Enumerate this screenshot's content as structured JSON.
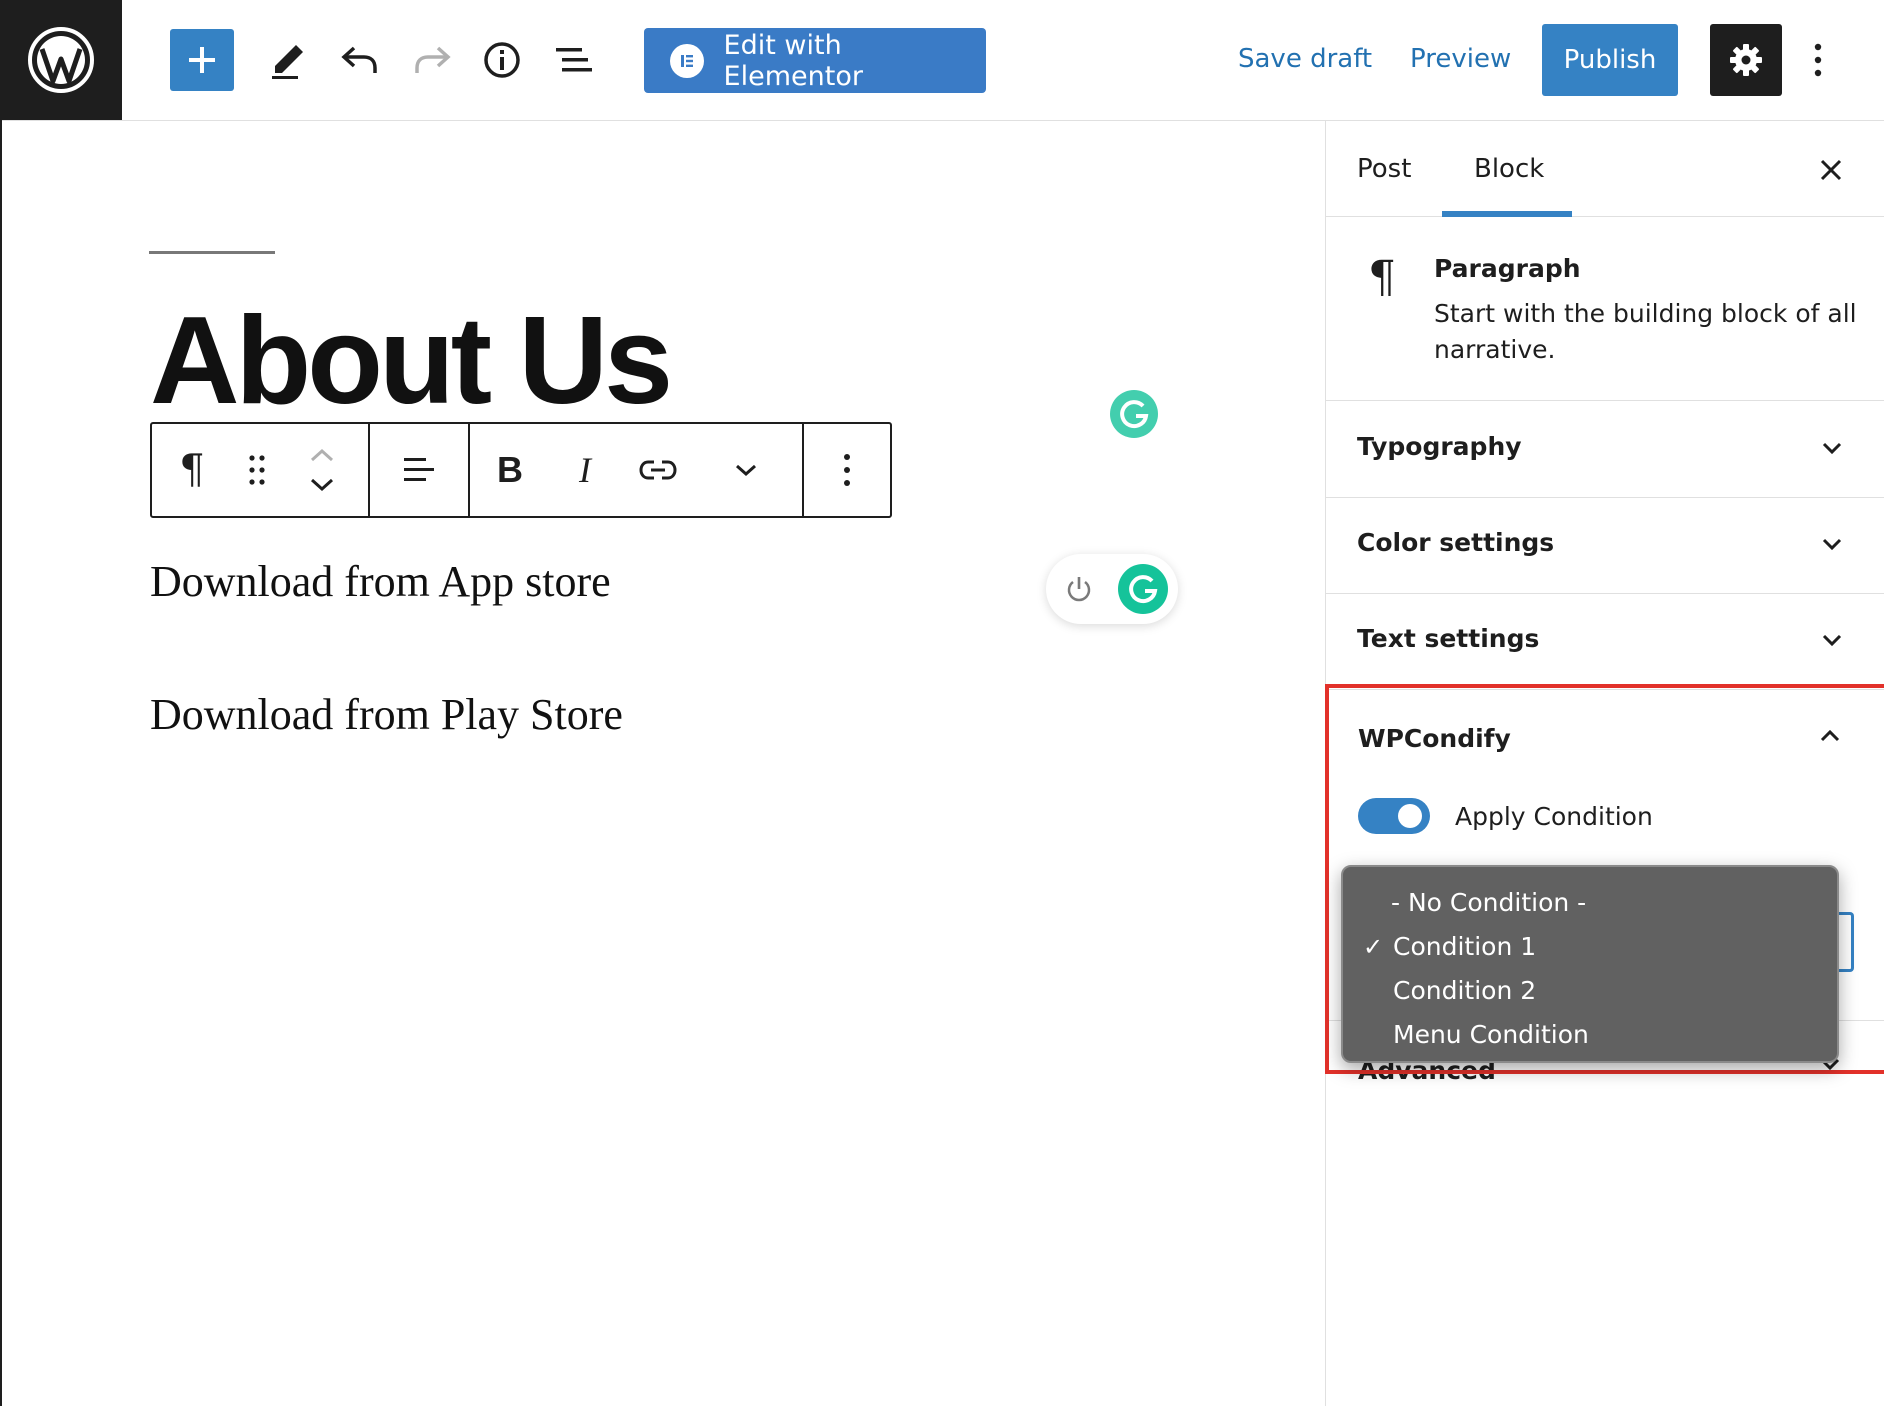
{
  "toolbar": {
    "edit_elementor_label": "Edit with Elementor",
    "save_draft_label": "Save draft",
    "preview_label": "Preview",
    "publish_label": "Publish"
  },
  "editor": {
    "title": "About Us",
    "paragraphs": [
      "Download from App store",
      "Download from Play Store"
    ],
    "block_toolbar": {
      "paragraph_glyph": "¶",
      "bold_glyph": "B",
      "italic_glyph": "I"
    }
  },
  "sidebar": {
    "tabs": [
      {
        "label": "Post"
      },
      {
        "label": "Block"
      }
    ],
    "active_tab": "Block",
    "block_info": {
      "title": "Paragraph",
      "description": "Start with the building block of all narrative."
    },
    "panels": [
      {
        "label": "Typography"
      },
      {
        "label": "Color settings"
      },
      {
        "label": "Text settings"
      }
    ],
    "wpcondify": {
      "title": "WPCondify",
      "toggle_label": "Apply Condition",
      "toggle_on": true,
      "options": [
        "- No Condition -",
        "Condition 1",
        "Condition 2",
        "Menu Condition"
      ],
      "selected": "Condition 1"
    },
    "advanced_label": "Advanced"
  },
  "colors": {
    "accent": "#3582c4",
    "highlight": "#e2312a",
    "grammarly": "#15c39a"
  }
}
